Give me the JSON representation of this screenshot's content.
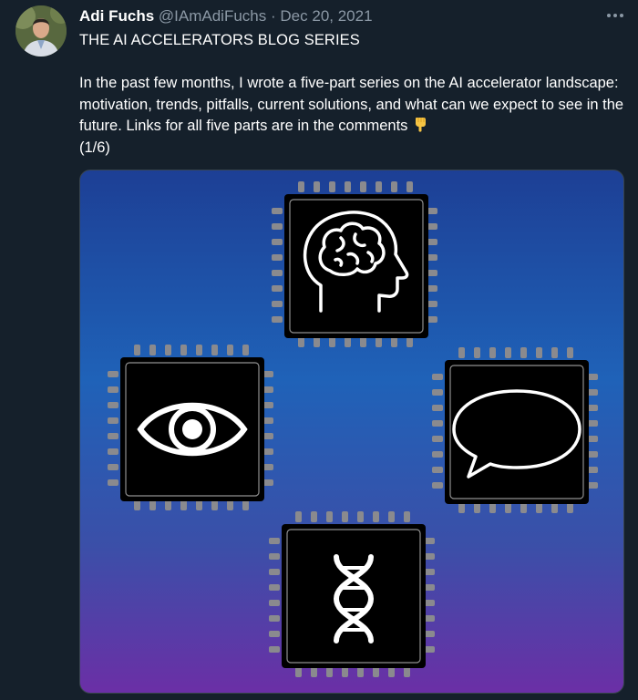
{
  "author": {
    "name": "Adi Fuchs",
    "handle": "@IAmAdiFuchs",
    "separator": "·",
    "date": "Dec 20, 2021"
  },
  "tweet": {
    "title": "THE AI ACCELERATORS BLOG SERIES",
    "body": "In the past few months, I wrote a five-part series on the AI accelerator landscape: motivation, trends, pitfalls, current solutions, and what can we expect to see in the future. Links for all five parts are in the comments",
    "counter": "(1/6)"
  },
  "media": {
    "chips": [
      "brain-icon",
      "eye-icon",
      "speech-bubble-icon",
      "dna-icon"
    ],
    "colors": {
      "top": "#1d3f95",
      "middle": "#1f62b8",
      "bottom": "#6b2fa6"
    }
  },
  "icons": {
    "more": "more-horizontal-icon",
    "emoji": "backhand-index-pointing-down"
  }
}
